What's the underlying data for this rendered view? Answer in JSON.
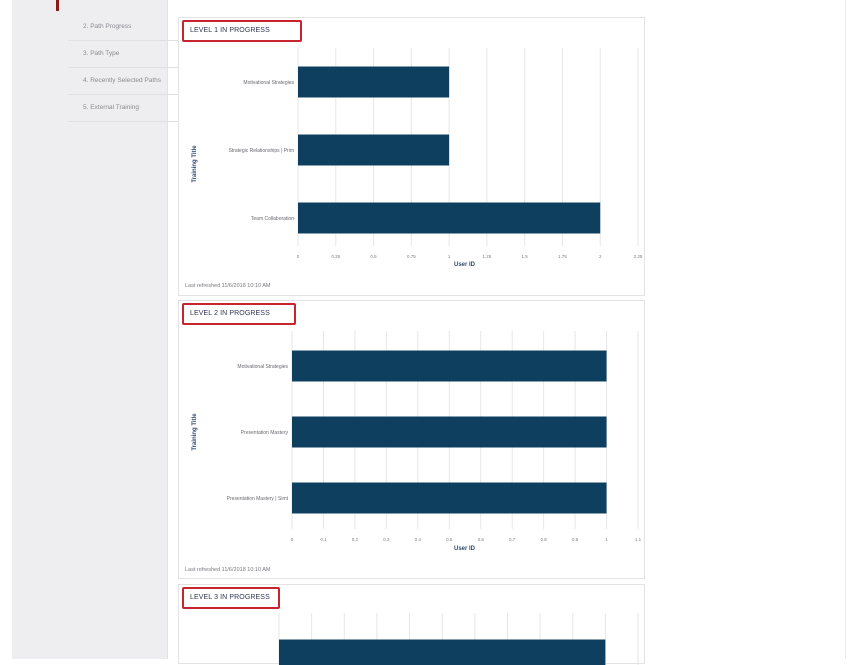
{
  "sidebar": {
    "items": [
      {
        "label": "2. Path Progress"
      },
      {
        "label": "3. Path Type"
      },
      {
        "label": "4. Recently Selected Paths"
      },
      {
        "label": "5. External Training"
      }
    ]
  },
  "colors": {
    "bar": "#0f3f5e",
    "highlight_border": "#c7242f",
    "grid": "#e6e6e9"
  },
  "panels": [
    {
      "title": "LEVEL 1 IN PROGRESS",
      "refreshed": "Last refreshed 11/6/2018 10:10 AM"
    },
    {
      "title": "LEVEL 2 IN PROGRESS",
      "refreshed": "Last refreshed 11/6/2018 10:10 AM"
    },
    {
      "title": "LEVEL 3 IN PROGRESS"
    }
  ],
  "chart_data": [
    {
      "type": "bar",
      "orientation": "horizontal",
      "categories": [
        "Motivational Strategies",
        "Strategic Relationships | Prim",
        "Team Collaboration"
      ],
      "values": [
        1,
        1,
        2
      ],
      "xlabel": "User ID",
      "ylabel": "Training Title",
      "xlim": [
        0,
        2.25
      ],
      "xticks": [
        "0",
        "0.25",
        "0.5",
        "0.75",
        "1",
        "1.25",
        "1.5",
        "1.75",
        "2",
        "2.25"
      ],
      "grid": true
    },
    {
      "type": "bar",
      "orientation": "horizontal",
      "categories": [
        "Motivational Strategies",
        "Presentation Mastery",
        "Presentation Mastery | Simt"
      ],
      "values": [
        1,
        1,
        1
      ],
      "xlabel": "User ID",
      "ylabel": "Training Title",
      "xlim": [
        0,
        1.1
      ],
      "xticks": [
        "0",
        "0.1",
        "0.2",
        "0.3",
        "0.4",
        "0.5",
        "0.6",
        "0.7",
        "0.8",
        "0.9",
        "1",
        "1.1"
      ],
      "grid": true
    },
    {
      "type": "bar",
      "orientation": "horizontal",
      "categories": [],
      "values": [
        1
      ],
      "xlim": [
        0,
        1.1
      ],
      "grid": true
    }
  ]
}
